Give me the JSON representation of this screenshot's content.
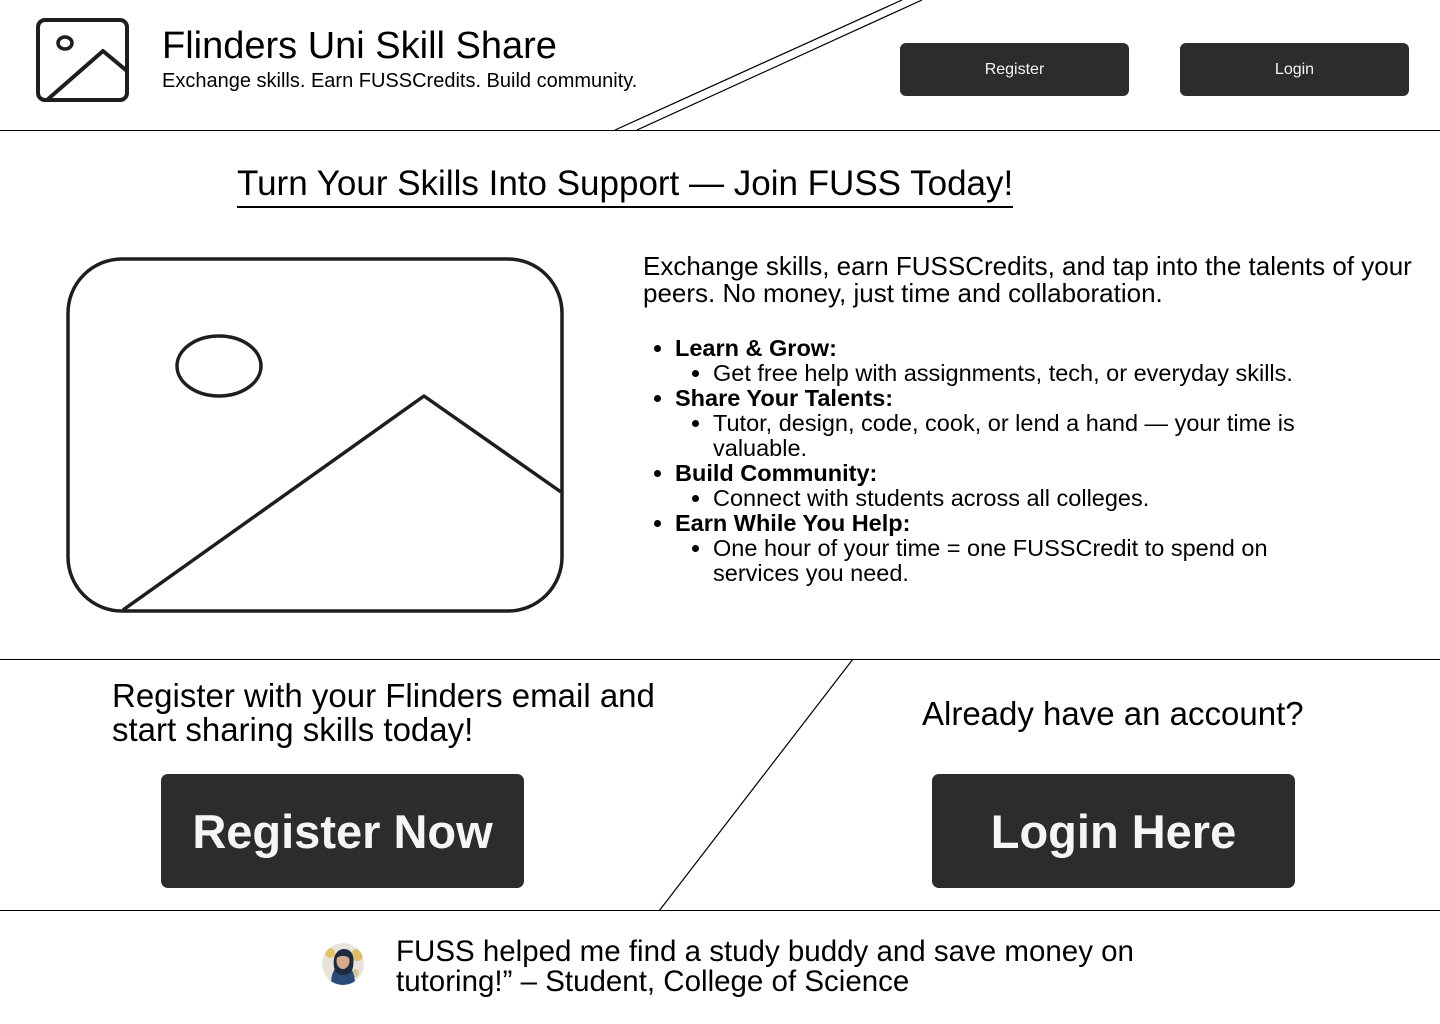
{
  "header": {
    "title": "Flinders Uni Skill Share",
    "tagline": "Exchange skills. Earn FUSSCredits. Build community.",
    "register_label": "Register",
    "login_label": "Login"
  },
  "hero": {
    "title": "Turn Your Skills Into Support — Join FUSS Today!",
    "intro": "Exchange skills, earn FUSSCredits, and tap into the talents of your peers. No money, just time and collaboration.",
    "benefits": [
      {
        "title": "Learn & Grow:",
        "detail": "Get free help with assignments, tech, or everyday skills."
      },
      {
        "title": "Share Your Talents:",
        "detail": "Tutor, design, code, cook, or lend a hand — your time is valuable."
      },
      {
        "title": "Build Community:",
        "detail": "Connect with students across all colleges."
      },
      {
        "title": "Earn While You Help:",
        "detail": "One hour of your time = one FUSSCredit to spend on services you need."
      }
    ]
  },
  "cta": {
    "register_text": "Register with your Flinders email and start sharing skills today!",
    "register_button": "Register Now",
    "login_text": "Already have an account?",
    "login_button": "Login Here"
  },
  "testimonial": {
    "quote": "FUSS helped me find a study buddy and save money on tutoring!” – Student, College of Science"
  },
  "colors": {
    "button_bg": "#2c2c2c",
    "button_text": "#f5f5f5",
    "line": "#000000",
    "icon_stroke": "#1e1e1e"
  },
  "icons": {
    "logo": "image-placeholder-icon",
    "hero_image": "image-placeholder-icon",
    "avatar": "student-avatar"
  }
}
